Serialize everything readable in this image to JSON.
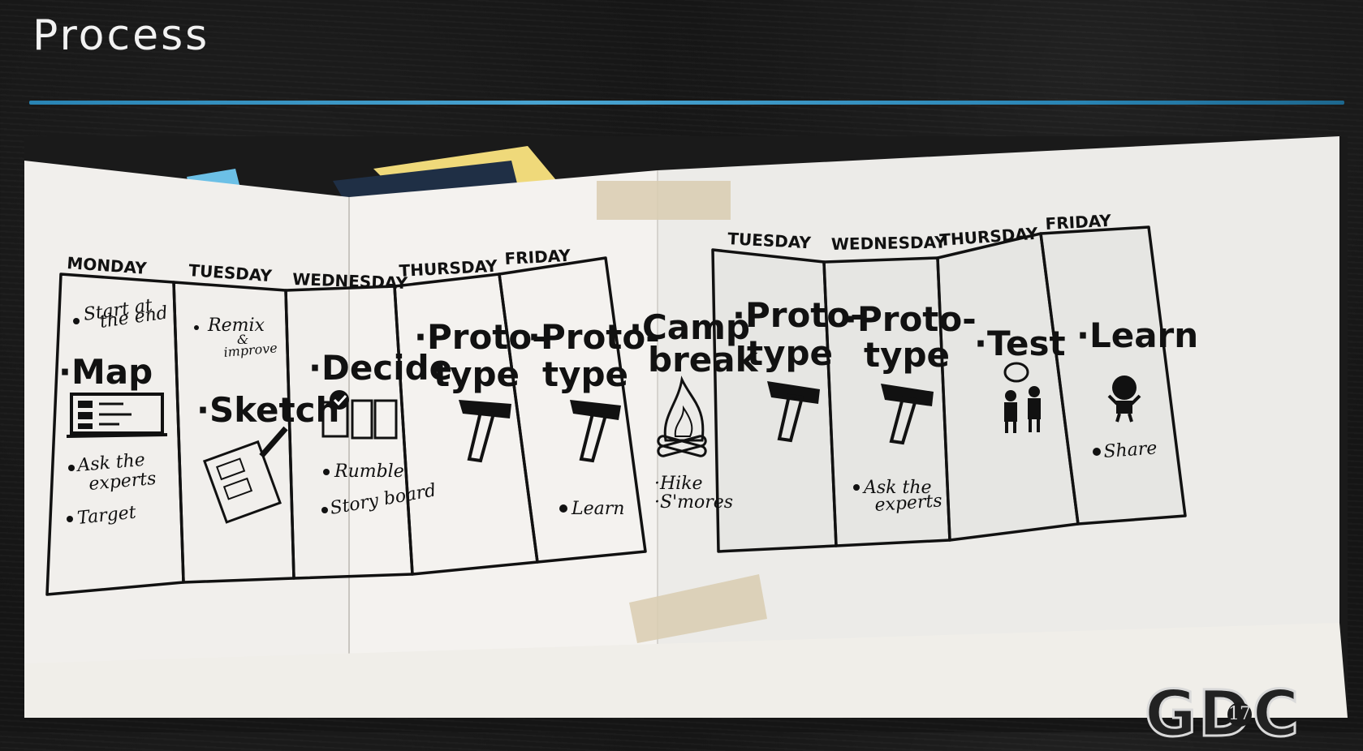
{
  "slide": {
    "title": "Process",
    "slide_number": "17",
    "logo_text": "GDC"
  },
  "board": {
    "columns": [
      {
        "day": "MONDAY",
        "title": "·Map",
        "notes_top": [
          "Start at",
          "the end"
        ],
        "notes_bottom": [
          "Ask the",
          "experts",
          "Target"
        ],
        "icon": "whiteboard-icon"
      },
      {
        "day": "TUESDAY",
        "title": "·Sketch",
        "notes_top": [
          "Remix",
          "&",
          "improve"
        ],
        "notes_bottom": [],
        "icon": "sketch-pad-icon"
      },
      {
        "day": "WEDNESDAY",
        "title": "·Decide",
        "notes_top": [],
        "notes_bottom": [
          "Rumble",
          "Story board"
        ],
        "icon": "checkbox-choice-icon"
      },
      {
        "day": "THURSDAY",
        "title_lines": [
          "·Proto-",
          "type"
        ],
        "notes_bottom": [],
        "icon": "hammer-icon"
      },
      {
        "day": "FRIDAY",
        "title_lines": [
          "·Proto-",
          "type"
        ],
        "notes_bottom": [
          "Learn"
        ],
        "icon": "hammer-icon"
      },
      {
        "day": "",
        "title_lines": [
          "·Camp",
          "break"
        ],
        "notes_bottom": [
          "·Hike",
          "·S'mores"
        ],
        "icon": "campfire-icon"
      },
      {
        "day": "TUESDAY",
        "title_lines": [
          "·Proto-",
          "type"
        ],
        "notes_bottom": [],
        "icon": "hammer-icon"
      },
      {
        "day": "WEDNESDAY",
        "title_lines": [
          "·Proto-",
          "type"
        ],
        "notes_bottom": [
          "Ask the",
          "experts"
        ],
        "icon": "hammer-icon"
      },
      {
        "day": "THURSDAY",
        "title": "·Test",
        "notes_bottom": [],
        "icon": "people-talking-icon"
      },
      {
        "day": "FRIDAY",
        "title": "·Learn",
        "notes_bottom": [
          "Share"
        ],
        "icon": "person-icon"
      }
    ]
  },
  "colors": {
    "background": "#151515",
    "accent": "#4fb4e6",
    "paper": "#f1efec",
    "ink": "#111111"
  }
}
